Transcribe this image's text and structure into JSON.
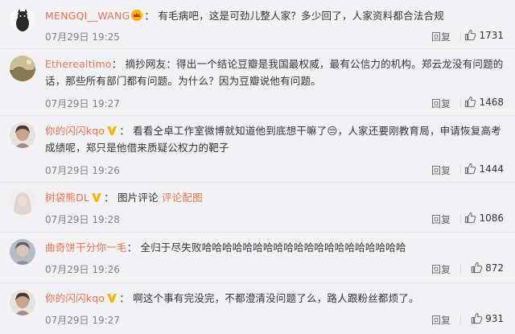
{
  "comments": [
    {
      "username": "MENGQI__WANG",
      "badge": "crown-icon",
      "separator": "：",
      "text": "有毛病吧，这是可劲儿整人家？多少回了，人家资料都合法合规",
      "time": "07月29日 19:25",
      "reply_label": "回复",
      "likes": "1731",
      "avatar_color": "#2a2a2a"
    },
    {
      "username": "Etherealtimo",
      "badge": "",
      "separator": "：",
      "text": "摘抄网友：得出一个结论豆瓣是我国最权威，最有公信力的机构。郑云龙没有问题的话，那些所有部门都有问题。为什么？因为豆瓣说他有问题。",
      "time": "07月29日 19:27",
      "reply_label": "回复",
      "likes": "1468",
      "avatar_color": "#6b5a3e"
    },
    {
      "username": "你的闪闪kqo",
      "badge": "v-icon",
      "separator": "：",
      "text": "看看仝卓工作室微博就知道他到底想干嘛了😒，人家还要刚教育局，申请恢复高考成绩呢，郑只是他借来质疑公权力的靶子",
      "time": "07月29日 19:26",
      "reply_label": "回复",
      "likes": "1444",
      "avatar_color": "#c9c3bd"
    },
    {
      "username": "树袋熊DL",
      "badge": "v-icon",
      "separator": "：",
      "text": "图片评论",
      "link_text": "评论配图",
      "time": "07月29日 19:28",
      "reply_label": "回复",
      "likes": "1086",
      "avatar_color": "#d8d2cf"
    },
    {
      "username": "曲奇饼干分你一毛",
      "badge": "",
      "separator": "：",
      "text": "全归于尽失败哈哈哈哈哈哈哈哈哈哈哈哈哈哈哈哈哈哈哈哈",
      "time": "07月29日 19:26",
      "reply_label": "回复",
      "likes": "872",
      "avatar_color": "#8a9099"
    },
    {
      "username": "你的闪闪kqo",
      "badge": "v-icon",
      "separator": "：",
      "text": "啊这个事有完没完，不都澄清没问题了么，路人跟粉丝都烦了。",
      "time": "07月29日 19:27",
      "reply_label": "回复",
      "likes": "931",
      "avatar_color": "#c9c3bd"
    }
  ]
}
